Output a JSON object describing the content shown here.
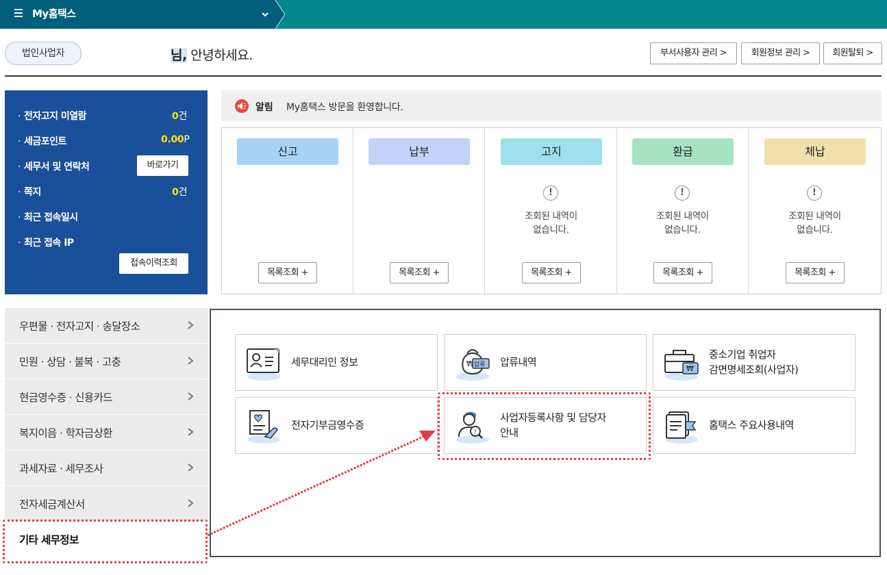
{
  "topbar": {
    "title": "My홈택스"
  },
  "header": {
    "badge": "법인사업자",
    "greeting_name": "님,",
    "greeting_text": " 안녕하세요.",
    "buttons": [
      "부서사용자 관리 >",
      "회원정보 관리 >",
      "회원탈퇴 >"
    ]
  },
  "info": {
    "rows": [
      {
        "label": "전자고지 미열람",
        "value": "0",
        "unit": "건"
      },
      {
        "label": "세금포인트",
        "value": "0.00",
        "unit": "P"
      },
      {
        "label": "세무서 및 연락처",
        "button": "바로가기"
      },
      {
        "label": "쪽지",
        "value": "0",
        "unit": "건"
      },
      {
        "label": "최근 접속일시"
      },
      {
        "label": "최근 접속 IP"
      }
    ],
    "history_button": "접속이력조회"
  },
  "notice": {
    "label": "알림",
    "text": "My홈택스 방문을 환영합니다."
  },
  "status": {
    "columns": [
      {
        "title": "신고",
        "color": "#a9d2f5",
        "empty": ""
      },
      {
        "title": "납부",
        "color": "#c3d2f7",
        "empty": ""
      },
      {
        "title": "고지",
        "color": "#9ee0ee",
        "empty": "조회된 내역이\n없습니다."
      },
      {
        "title": "환급",
        "color": "#a6e3c3",
        "empty": "조회된 내역이\n없습니다."
      },
      {
        "title": "체납",
        "color": "#f1dfac",
        "empty": "조회된 내역이\n없습니다."
      }
    ],
    "list_button": "목록조회 +",
    "empty_line1": "조회된 내역이",
    "empty_line2": "없습니다."
  },
  "menu": {
    "items": [
      "우편물 · 전자고지 · 송달장소",
      "민원 · 상담 · 불복 · 고충",
      "현금영수증 · 신용카드",
      "복지이음 · 학자금상환",
      "과세자료 · 세무조사",
      "전자세금계산서",
      "기타 세무정보"
    ],
    "active": "기타 세무정보"
  },
  "cards": [
    {
      "line1": "세무대리인 정보",
      "line2": "",
      "icon": "agent-info-icon"
    },
    {
      "line1": "압류내역",
      "line2": "",
      "icon": "seizure-icon",
      "icon_text": "압류"
    },
    {
      "line1": "중소기업 취업자",
      "line2": "감면명세조회(사업자)",
      "icon": "employment-icon"
    },
    {
      "line1": "전자기부금영수증",
      "line2": "",
      "icon": "donation-receipt-icon"
    },
    {
      "line1": "사업자등록사항 및 담당자",
      "line2": "안내",
      "icon": "business-registration-icon"
    },
    {
      "line1": "홈택스 주요사용내역",
      "line2": "",
      "icon": "usage-history-icon"
    }
  ],
  "colors": {
    "topbar": "#00888e",
    "topbar_first": "#005f7a",
    "info_panel": "#1a4f9a",
    "highlight": "#e53a4a"
  }
}
